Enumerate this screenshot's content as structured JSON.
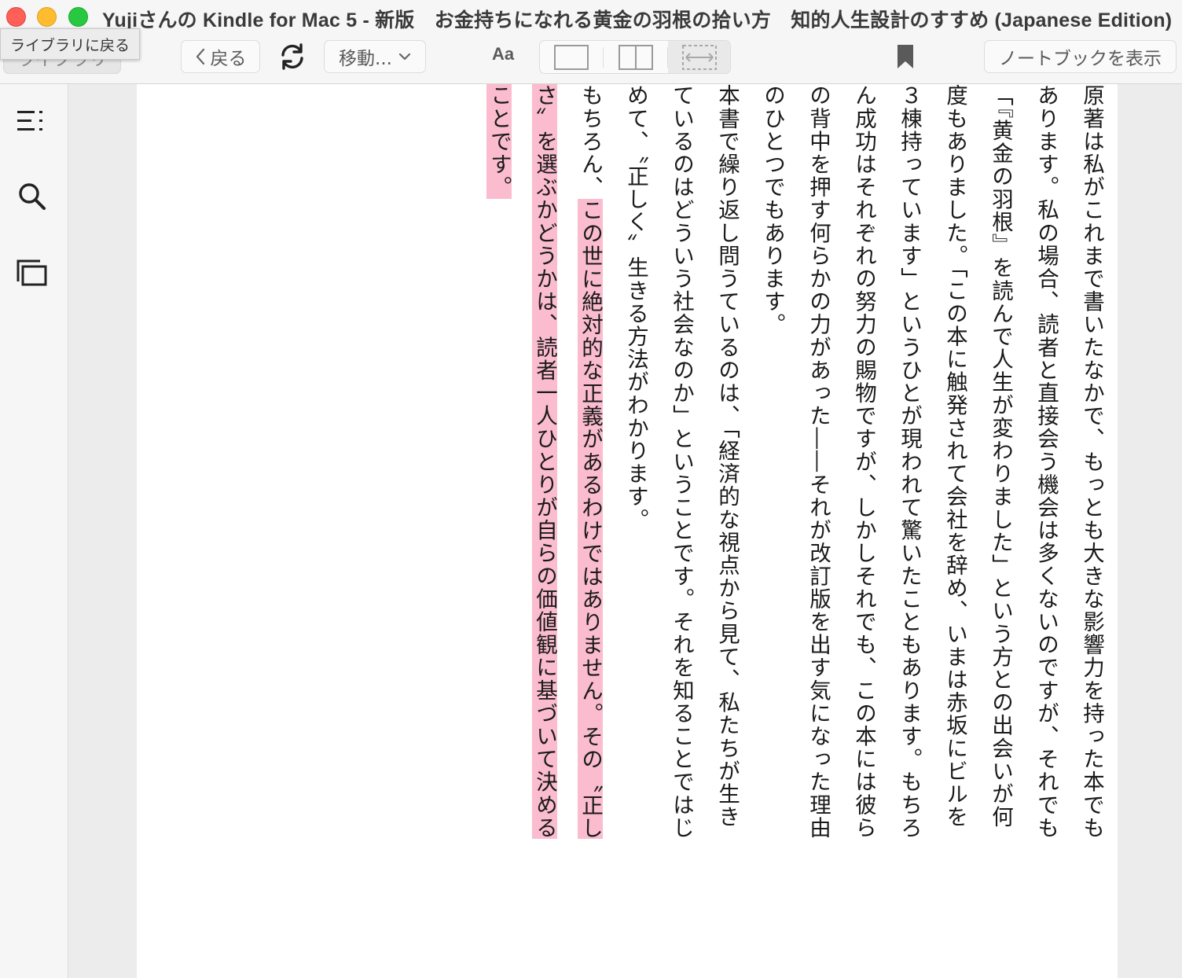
{
  "window": {
    "title": "Yujiさんの Kindle for Mac 5 - 新版　お金持ちになれる黄金の羽根の拾い方　知的人生設計のすすめ (Japanese Edition)"
  },
  "toolbar": {
    "library_label": "ライブラリ",
    "library_tooltip": "ライブラリに戻る",
    "back_label": "戻る",
    "move_label": "移動...",
    "font_label": "Aa",
    "notebook_label": "ノートブックを表示"
  },
  "icons": {
    "sync": "sync-icon",
    "bookmark": "bookmark-icon",
    "toc": "table-of-contents-icon",
    "search": "search-icon",
    "flashcards": "flashcards-icon",
    "single_page": "single-page-layout-icon",
    "two_page": "two-page-layout-icon",
    "full_width": "full-width-layout-icon"
  },
  "colors": {
    "highlight": "#fbbcd0"
  },
  "book": {
    "p1": "原著は私がこれまで書いたなかで、もっとも大きな影響力を持った本でもあります。私の場合、読者と直接会う機会は多くないのですが、それでも「『黄金の羽根』を読んで人生が変わりました」という方との出会いが何度もありました。「この本に触発されて会社を辞め、いまは赤坂にビルを３棟持っています」というひとが現われて驚いたこともあります。もちろん成功はそれぞれの努力の賜物ですが、しかしそれでも、この本には彼らの背中を押す何らかの力があった――それが改訂版を出す気になった理由のひとつでもあります。",
    "p2": "本書で繰り返し問うているのは、「経済的な視点から見て、私たちが生きているのはどういう社会なのか」ということです。それを知ることではじめて、〝正しく〟生きる方法がわかります。",
    "p3_plain": "もちろん、",
    "p3_highlight": "この世に絶対的な正義があるわけではありません。その〝正しさ〟を選ぶかどうかは、読者一人ひとりが自らの価値観に基づいて決めることです。"
  }
}
